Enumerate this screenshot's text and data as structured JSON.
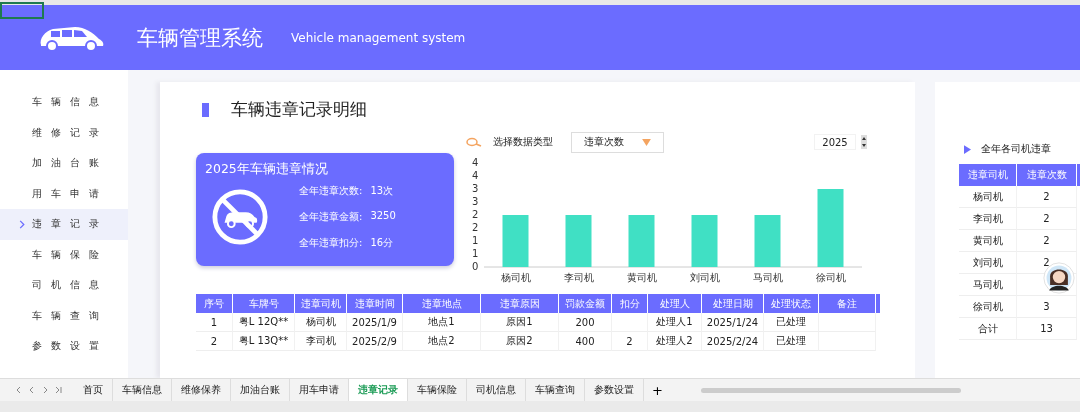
{
  "header": {
    "title": "车辆管理系统",
    "subtitle": "Vehicle management system"
  },
  "sidebar": {
    "items": [
      {
        "label": "车辆信息",
        "selected": false
      },
      {
        "label": "维修记录",
        "selected": false
      },
      {
        "label": "加油台账",
        "selected": false
      },
      {
        "label": "用车申请",
        "selected": false
      },
      {
        "label": "违章记录",
        "selected": true
      },
      {
        "label": "车辆保险",
        "selected": false
      },
      {
        "label": "司机信息",
        "selected": false
      },
      {
        "label": "车辆查询",
        "selected": false
      },
      {
        "label": "参数设置",
        "selected": false
      }
    ]
  },
  "page_title": "车辆违章记录明细",
  "summary": {
    "title": "2025年车辆违章情况",
    "stats": [
      {
        "label": "全年违章次数:",
        "value": "13次"
      },
      {
        "label": "全年违章金额:",
        "value": "3250"
      },
      {
        "label": "全年违章扣分:",
        "value": "16分"
      }
    ]
  },
  "filter": {
    "label": "选择数据类型",
    "value": "违章次数",
    "year": "2025"
  },
  "chart_data": {
    "type": "bar",
    "categories": [
      "杨司机",
      "李司机",
      "黄司机",
      "刘司机",
      "马司机",
      "徐司机"
    ],
    "values": [
      2,
      2,
      2,
      2,
      2,
      3
    ],
    "ylim": [
      0,
      4
    ],
    "yticks": [
      {
        "value": 0,
        "label": "0"
      },
      {
        "value": 0.5,
        "label": "1"
      },
      {
        "value": 1,
        "label": "1"
      },
      {
        "value": 1.5,
        "label": "2"
      },
      {
        "value": 2,
        "label": "2"
      },
      {
        "value": 2.5,
        "label": "3"
      },
      {
        "value": 3,
        "label": "3"
      },
      {
        "value": 3.5,
        "label": "4"
      },
      {
        "value": 4,
        "label": "4"
      }
    ]
  },
  "table": {
    "columns": [
      "序号",
      "车牌号",
      "违章司机",
      "违章时间",
      "违章地点",
      "违章原因",
      "罚款金额",
      "扣分",
      "处理人",
      "处理日期",
      "处理状态",
      "备注"
    ],
    "rows": [
      {
        "cells": [
          "1",
          "粤L 12Q**",
          "杨司机",
          "2025/1/9",
          "地点1",
          "原因1",
          "200",
          null,
          "处理人1",
          "2025/1/24",
          "已处理",
          null
        ]
      },
      {
        "cells": [
          "2",
          "粤L 13Q**",
          "李司机",
          "2025/2/9",
          "地点2",
          "原因2",
          "400",
          "2",
          "处理人2",
          "2025/2/24",
          "已处理",
          null
        ]
      }
    ]
  },
  "driver_summary": {
    "title": "全年各司机违章",
    "columns": [
      "违章司机",
      "违章次数"
    ],
    "rows": [
      {
        "driver": "杨司机",
        "count": "2"
      },
      {
        "driver": "李司机",
        "count": "2"
      },
      {
        "driver": "黄司机",
        "count": "2"
      },
      {
        "driver": "刘司机",
        "count": "2"
      },
      {
        "driver": "马司机",
        "count": null
      },
      {
        "driver": "徐司机",
        "count": "3"
      },
      {
        "driver": "合计",
        "count": "13"
      }
    ]
  },
  "sheet_tabs": [
    {
      "label": "首页",
      "selected": false
    },
    {
      "label": "车辆信息",
      "selected": false
    },
    {
      "label": "维修保养",
      "selected": false
    },
    {
      "label": "加油台账",
      "selected": false
    },
    {
      "label": "用车申请",
      "selected": false
    },
    {
      "label": "违章记录",
      "selected": true
    },
    {
      "label": "车辆保险",
      "selected": false
    },
    {
      "label": "司机信息",
      "selected": false
    },
    {
      "label": "车辆查询",
      "selected": false
    },
    {
      "label": "参数设置",
      "selected": false
    }
  ],
  "add_sheet": "+"
}
